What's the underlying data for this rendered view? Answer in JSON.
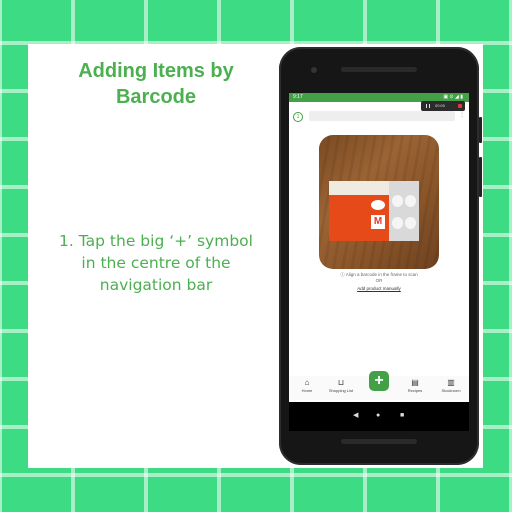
{
  "slide": {
    "title_line1": "Adding Items by",
    "title_line2": "Barcode",
    "instruction": "1. Tap the big ‘+’ symbol in the centre of the navigation bar"
  },
  "phone": {
    "status_time": "9:17",
    "status_icons": "▣ ⊙ ◢ ▮",
    "recorder_time": "00:00",
    "appbar_left": "1",
    "appbar_right": "⋮",
    "scan_hint": "ⓘ Align a barcode in the frame to scan",
    "or_text": "OR",
    "add_manually": "Add product manually",
    "nav": [
      {
        "label": "Home",
        "icon": "home-icon",
        "glyph": "⌂"
      },
      {
        "label": "Shopping List",
        "icon": "cart-icon",
        "glyph": "🛒"
      },
      {
        "label": "+",
        "icon": "add-icon",
        "glyph": "+"
      },
      {
        "label": "Recipes",
        "icon": "recipe-icon",
        "glyph": "▤"
      },
      {
        "label": "Stockroom",
        "icon": "stockroom-icon",
        "glyph": "▥"
      }
    ],
    "carton_letter": "M"
  },
  "colors": {
    "background": "#3ddc84",
    "accent_green": "#4caf50",
    "carton_orange": "#e64a19"
  }
}
